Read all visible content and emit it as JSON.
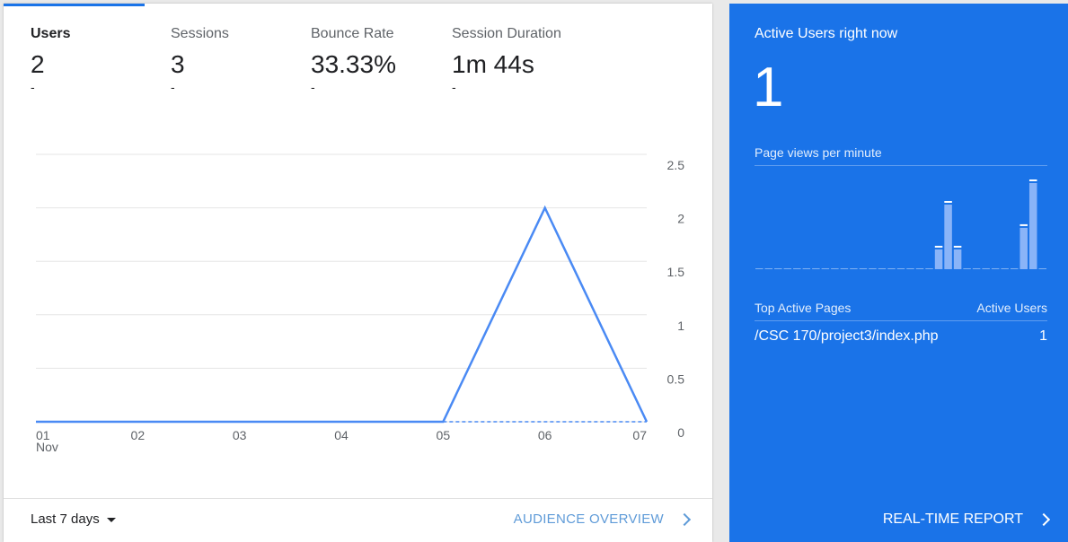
{
  "metrics": [
    {
      "label": "Users",
      "value": "2",
      "delta": "-",
      "active": true
    },
    {
      "label": "Sessions",
      "value": "3",
      "delta": "-",
      "active": false
    },
    {
      "label": "Bounce Rate",
      "value": "33.33%",
      "delta": "-",
      "active": false
    },
    {
      "label": "Session Duration",
      "value": "1m 44s",
      "delta": "-",
      "active": false
    }
  ],
  "chart_data": {
    "type": "line",
    "x": [
      "01",
      "02",
      "03",
      "04",
      "05",
      "06",
      "07"
    ],
    "x_month_label": "Nov",
    "series": [
      {
        "values": [
          0,
          0,
          0,
          0,
          0,
          2,
          0
        ]
      }
    ],
    "y_ticks": [
      "0",
      "0.5",
      "1",
      "1.5",
      "2",
      "2.5"
    ],
    "ylim": [
      0,
      2.5
    ],
    "grid": true,
    "line_color": "#4a8af4"
  },
  "footer": {
    "date_range": "Last 7 days",
    "audience_link": "AUDIENCE OVERVIEW"
  },
  "realtime": {
    "title": "Active Users right now",
    "count": "1",
    "pageviews_label": "Page views per minute",
    "pageviews_bars": [
      0,
      0,
      0,
      0,
      0,
      0,
      0,
      0,
      0,
      0,
      0,
      0,
      0,
      0,
      0,
      0,
      0,
      0,
      0,
      0.23,
      0.75,
      0.23,
      0,
      0,
      0,
      0,
      0,
      0,
      0.48,
      1.0,
      0
    ],
    "table_header_left": "Top Active Pages",
    "table_header_right": "Active Users",
    "rows": [
      {
        "page": "/CSC 170/project3/index.php",
        "users": "1"
      }
    ],
    "report_link": "REAL-TIME REPORT"
  },
  "colors": {
    "accent": "#1a73e8",
    "link": "#5f9bd8"
  }
}
